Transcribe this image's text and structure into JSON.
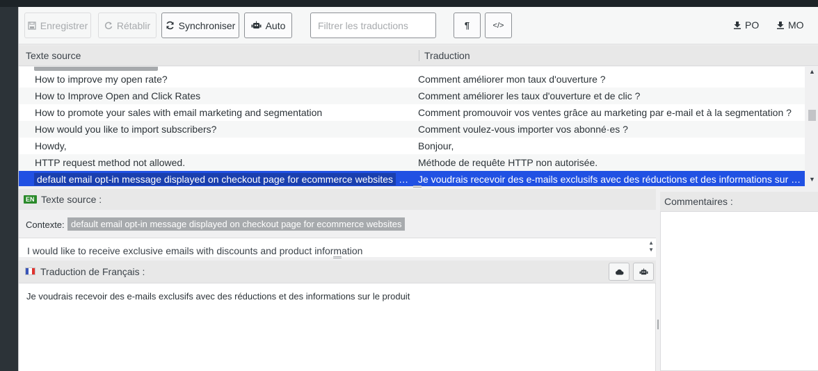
{
  "toolbar": {
    "save_label": "Enregistrer",
    "revert_label": "Rétablir",
    "sync_label": "Synchroniser",
    "auto_label": "Auto",
    "filter_placeholder": "Filtrer les traductions",
    "invisibles_icon": "¶",
    "code_icon": "</>",
    "po_label": "PO",
    "mo_label": "MO"
  },
  "table": {
    "col_source": "Texte source",
    "col_translation": "Traduction",
    "rows": [
      {
        "source": "How to improve my open rate?",
        "translation": "Comment améliorer mon taux d'ouverture ?"
      },
      {
        "source": "How to Improve Open and Click Rates",
        "translation": "Comment améliorer les taux d'ouverture et de clic ?"
      },
      {
        "source": "How to promote your sales with email marketing and segmentation",
        "translation": "Comment promouvoir vos ventes grâce au marketing par e-mail et à la segmentation ?"
      },
      {
        "source": "How would you like to import subscribers?",
        "translation": "Comment voulez-vous importer vos abonné·es ?"
      },
      {
        "source": "Howdy,",
        "translation": "Bonjour,"
      },
      {
        "source": "HTTP request method not allowed.",
        "translation": "Méthode de requête HTTP non autorisée."
      }
    ],
    "selected": {
      "context": "default email opt-in message displayed on checkout page for ecommerce websites",
      "source": "I would like to receive exclusive emails with discounts and product information",
      "translation": "Je voudrais recevoir des e-mails exclusifs avec des réductions et des informations sur le produit"
    }
  },
  "source_panel": {
    "lang_badge": "EN",
    "title": "Texte source :",
    "context_label": "Contexte:",
    "context_value": "default email opt-in message displayed on checkout page for ecommerce websites",
    "text": "I would like to receive exclusive emails with discounts and product information"
  },
  "translation_panel": {
    "title": "Traduction de Français :",
    "text": "Je voudrais recevoir des e-mails exclusifs avec des réductions et des informations sur le produit"
  },
  "comments_panel": {
    "title": "Commentaires :"
  },
  "colors": {
    "selection": "#2151e3",
    "badge": "#2a8a2a"
  }
}
